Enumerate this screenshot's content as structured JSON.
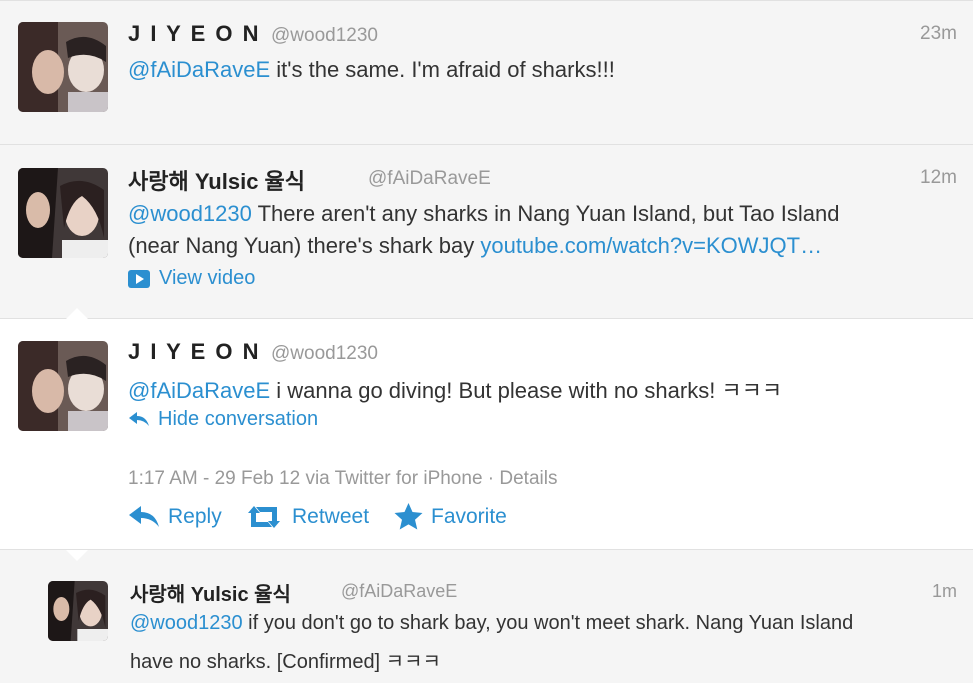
{
  "tweets": [
    {
      "fullname": "J I Y E O N",
      "handle": "@wood1230",
      "time": "23m",
      "mention": "@fAiDaRaveE",
      "text": " it's the same. I'm afraid of sharks!!!"
    },
    {
      "fullname": "사랑해 Yulsic 율식",
      "handle": "@fAiDaRaveE",
      "time": "12m",
      "mention": "@wood1230",
      "text_line1": " There aren't any sharks in Nang Yuan Island, but Tao Island",
      "text_line2": "(near Nang Yuan) there's shark bay ",
      "link": "youtube.com/watch?v=KOWJQT…",
      "view_video": "View video"
    },
    {
      "fullname": "J I Y E O N",
      "handle": "@wood1230",
      "mention": "@fAiDaRaveE",
      "text": " i wanna go diving! But please with no sharks! ㅋㅋㅋ",
      "hide_conversation": "Hide conversation",
      "meta": "1:17 AM - 29 Feb 12 via Twitter for iPhone · Details",
      "actions": {
        "reply": "Reply",
        "retweet": "Retweet",
        "favorite": "Favorite"
      }
    },
    {
      "fullname": "사랑해 Yulsic 율식",
      "handle": "@fAiDaRaveE",
      "time": "1m",
      "mention": "@wood1230",
      "text_line1": " if you don't go to shark bay, you won't meet shark. Nang Yuan Island",
      "text_line2": "have no sharks. [Confirmed] ㅋㅋㅋ"
    }
  ],
  "colors": {
    "link": "#2b8fd0",
    "muted": "#999999",
    "text": "#333333"
  },
  "icons": [
    "video-play-icon",
    "hide-conversation-icon",
    "reply-icon",
    "retweet-icon",
    "favorite-star-icon"
  ]
}
